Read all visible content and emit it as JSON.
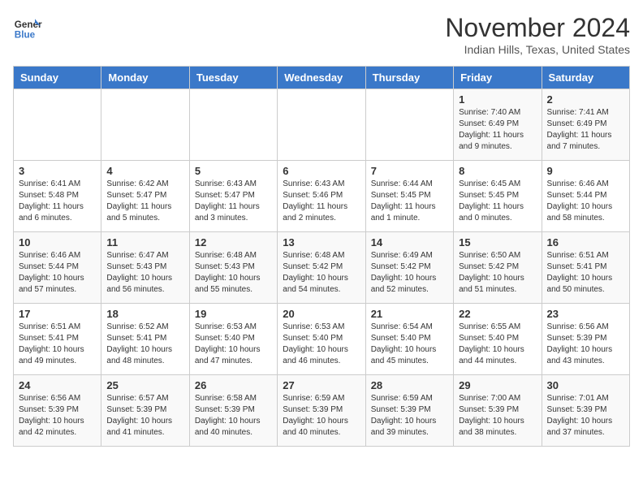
{
  "header": {
    "logo_line1": "General",
    "logo_line2": "Blue",
    "month": "November 2024",
    "location": "Indian Hills, Texas, United States"
  },
  "weekdays": [
    "Sunday",
    "Monday",
    "Tuesday",
    "Wednesday",
    "Thursday",
    "Friday",
    "Saturday"
  ],
  "weeks": [
    [
      {
        "day": "",
        "content": ""
      },
      {
        "day": "",
        "content": ""
      },
      {
        "day": "",
        "content": ""
      },
      {
        "day": "",
        "content": ""
      },
      {
        "day": "",
        "content": ""
      },
      {
        "day": "1",
        "content": "Sunrise: 7:40 AM\nSunset: 6:49 PM\nDaylight: 11 hours\nand 9 minutes."
      },
      {
        "day": "2",
        "content": "Sunrise: 7:41 AM\nSunset: 6:49 PM\nDaylight: 11 hours\nand 7 minutes."
      }
    ],
    [
      {
        "day": "3",
        "content": "Sunrise: 6:41 AM\nSunset: 5:48 PM\nDaylight: 11 hours\nand 6 minutes."
      },
      {
        "day": "4",
        "content": "Sunrise: 6:42 AM\nSunset: 5:47 PM\nDaylight: 11 hours\nand 5 minutes."
      },
      {
        "day": "5",
        "content": "Sunrise: 6:43 AM\nSunset: 5:47 PM\nDaylight: 11 hours\nand 3 minutes."
      },
      {
        "day": "6",
        "content": "Sunrise: 6:43 AM\nSunset: 5:46 PM\nDaylight: 11 hours\nand 2 minutes."
      },
      {
        "day": "7",
        "content": "Sunrise: 6:44 AM\nSunset: 5:45 PM\nDaylight: 11 hours\nand 1 minute."
      },
      {
        "day": "8",
        "content": "Sunrise: 6:45 AM\nSunset: 5:45 PM\nDaylight: 11 hours\nand 0 minutes."
      },
      {
        "day": "9",
        "content": "Sunrise: 6:46 AM\nSunset: 5:44 PM\nDaylight: 10 hours\nand 58 minutes."
      }
    ],
    [
      {
        "day": "10",
        "content": "Sunrise: 6:46 AM\nSunset: 5:44 PM\nDaylight: 10 hours\nand 57 minutes."
      },
      {
        "day": "11",
        "content": "Sunrise: 6:47 AM\nSunset: 5:43 PM\nDaylight: 10 hours\nand 56 minutes."
      },
      {
        "day": "12",
        "content": "Sunrise: 6:48 AM\nSunset: 5:43 PM\nDaylight: 10 hours\nand 55 minutes."
      },
      {
        "day": "13",
        "content": "Sunrise: 6:48 AM\nSunset: 5:42 PM\nDaylight: 10 hours\nand 54 minutes."
      },
      {
        "day": "14",
        "content": "Sunrise: 6:49 AM\nSunset: 5:42 PM\nDaylight: 10 hours\nand 52 minutes."
      },
      {
        "day": "15",
        "content": "Sunrise: 6:50 AM\nSunset: 5:42 PM\nDaylight: 10 hours\nand 51 minutes."
      },
      {
        "day": "16",
        "content": "Sunrise: 6:51 AM\nSunset: 5:41 PM\nDaylight: 10 hours\nand 50 minutes."
      }
    ],
    [
      {
        "day": "17",
        "content": "Sunrise: 6:51 AM\nSunset: 5:41 PM\nDaylight: 10 hours\nand 49 minutes."
      },
      {
        "day": "18",
        "content": "Sunrise: 6:52 AM\nSunset: 5:41 PM\nDaylight: 10 hours\nand 48 minutes."
      },
      {
        "day": "19",
        "content": "Sunrise: 6:53 AM\nSunset: 5:40 PM\nDaylight: 10 hours\nand 47 minutes."
      },
      {
        "day": "20",
        "content": "Sunrise: 6:53 AM\nSunset: 5:40 PM\nDaylight: 10 hours\nand 46 minutes."
      },
      {
        "day": "21",
        "content": "Sunrise: 6:54 AM\nSunset: 5:40 PM\nDaylight: 10 hours\nand 45 minutes."
      },
      {
        "day": "22",
        "content": "Sunrise: 6:55 AM\nSunset: 5:40 PM\nDaylight: 10 hours\nand 44 minutes."
      },
      {
        "day": "23",
        "content": "Sunrise: 6:56 AM\nSunset: 5:39 PM\nDaylight: 10 hours\nand 43 minutes."
      }
    ],
    [
      {
        "day": "24",
        "content": "Sunrise: 6:56 AM\nSunset: 5:39 PM\nDaylight: 10 hours\nand 42 minutes."
      },
      {
        "day": "25",
        "content": "Sunrise: 6:57 AM\nSunset: 5:39 PM\nDaylight: 10 hours\nand 41 minutes."
      },
      {
        "day": "26",
        "content": "Sunrise: 6:58 AM\nSunset: 5:39 PM\nDaylight: 10 hours\nand 40 minutes."
      },
      {
        "day": "27",
        "content": "Sunrise: 6:59 AM\nSunset: 5:39 PM\nDaylight: 10 hours\nand 40 minutes."
      },
      {
        "day": "28",
        "content": "Sunrise: 6:59 AM\nSunset: 5:39 PM\nDaylight: 10 hours\nand 39 minutes."
      },
      {
        "day": "29",
        "content": "Sunrise: 7:00 AM\nSunset: 5:39 PM\nDaylight: 10 hours\nand 38 minutes."
      },
      {
        "day": "30",
        "content": "Sunrise: 7:01 AM\nSunset: 5:39 PM\nDaylight: 10 hours\nand 37 minutes."
      }
    ]
  ]
}
